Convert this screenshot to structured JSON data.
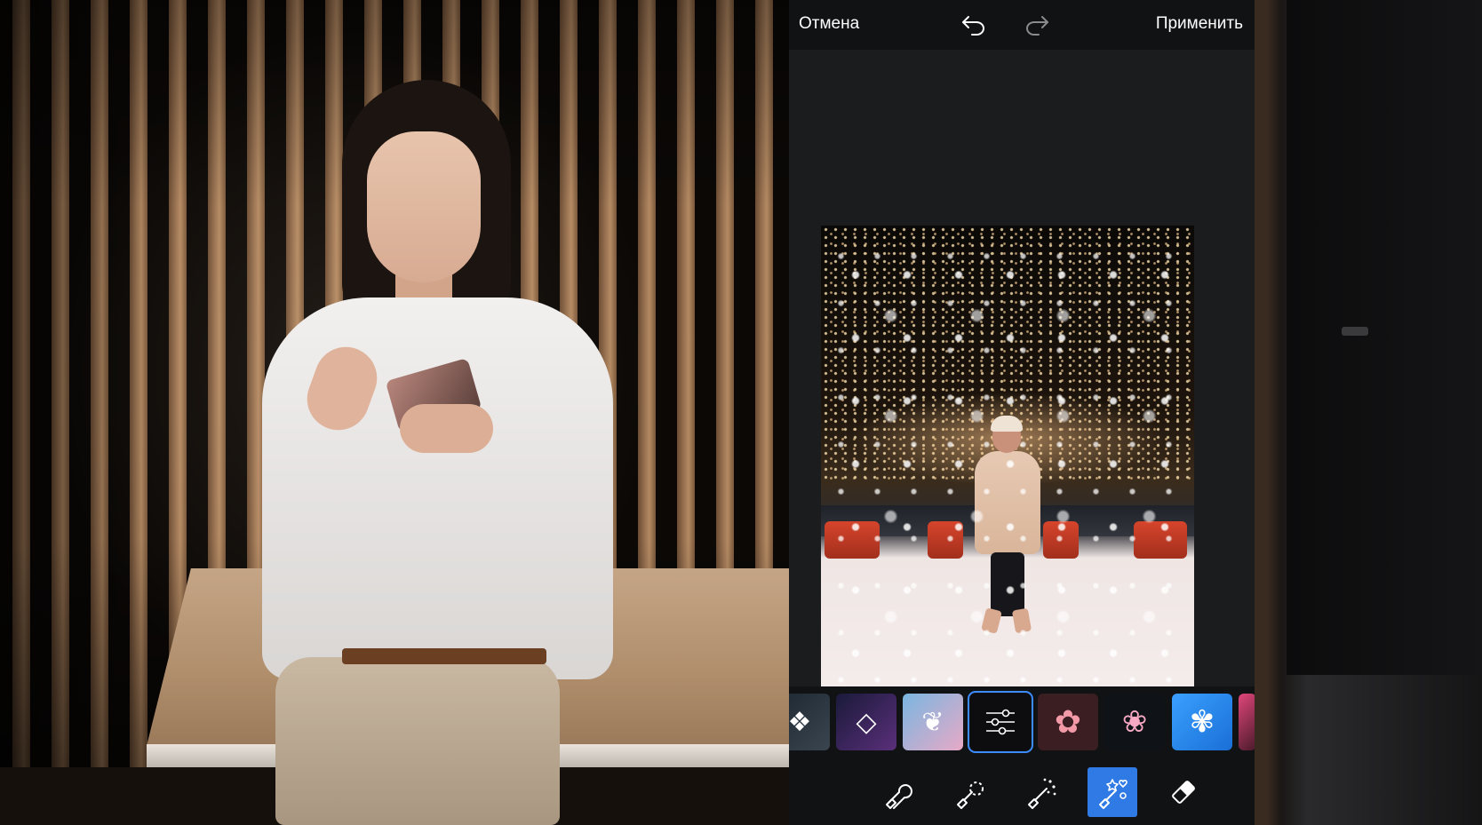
{
  "topbar": {
    "cancel_label": "Отмена",
    "apply_label": "Применить",
    "undo_icon": "undo-icon",
    "redo_icon": "redo-icon"
  },
  "sticker_strip": {
    "items": [
      {
        "name": "ice-cubes-sticker",
        "icon": "ice-cubes"
      },
      {
        "name": "geometric-crystal-sticker",
        "icon": "crystal"
      },
      {
        "name": "watercolor-sticker",
        "icon": "watercolor"
      },
      {
        "name": "adjust-sliders-sticker",
        "icon": "sliders-icon",
        "selected": true
      },
      {
        "name": "pink-flower-sticker",
        "icon": "flower"
      },
      {
        "name": "floral-pattern-sticker",
        "icon": "flowers"
      },
      {
        "name": "white-flowers-blue-sticker",
        "icon": "flowers"
      },
      {
        "name": "partial-sticker",
        "icon": "partial"
      }
    ]
  },
  "toolbar": {
    "tools": [
      {
        "name": "brush-tool",
        "icon": "brush-icon",
        "active": false
      },
      {
        "name": "dotted-brush-tool",
        "icon": "dotted-brush-icon",
        "active": false
      },
      {
        "name": "magic-wand-tool",
        "icon": "magic-wand-icon",
        "active": false
      },
      {
        "name": "sticker-brush-tool",
        "icon": "sticker-brush-icon",
        "active": true
      },
      {
        "name": "eraser-tool",
        "icon": "eraser-icon",
        "active": false
      }
    ]
  },
  "colors": {
    "accent": "#2f7ae5",
    "selected_outline": "#3c8cff",
    "app_bg": "#1b1c1e",
    "bar_bg": "#111213"
  }
}
